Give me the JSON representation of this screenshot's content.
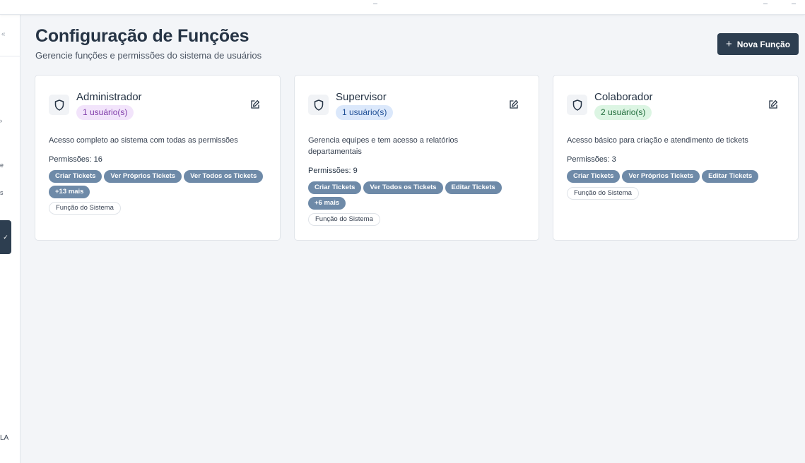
{
  "sidebar": {
    "collapse_icon": "«",
    "frag1": "›",
    "frag2": "e",
    "frag3": "s",
    "active_icon": "✓",
    "bottom_text": "LA"
  },
  "header": {
    "title": "Configuração de Funções",
    "subtitle": "Gerencie funções e permissões do sistema de usuários",
    "new_button_label": "Nova Função",
    "new_button_icon": "plus-icon"
  },
  "roles": [
    {
      "name": "Administrador",
      "users": "1 usuário(s)",
      "badge_bg": "#f2e4fb",
      "badge_fg": "#7e3aa8",
      "description": "Acesso completo ao sistema com todas as permissões",
      "permissions_label": "Permissões: 16",
      "tags": [
        "Criar Tickets",
        "Ver Próprios Tickets",
        "Ver Todos os Tickets",
        "+13 mais"
      ],
      "system_label": "Função do Sistema"
    },
    {
      "name": "Supervisor",
      "users": "1 usuário(s)",
      "badge_bg": "#dbe8fb",
      "badge_fg": "#1f4f96",
      "description": "Gerencia equipes e tem acesso a relatórios departamentais",
      "permissions_label": "Permissões: 9",
      "tags": [
        "Criar Tickets",
        "Ver Todos os Tickets",
        "Editar Tickets",
        "+6 mais"
      ],
      "system_label": "Função do Sistema"
    },
    {
      "name": "Colaborador",
      "users": "2 usuário(s)",
      "badge_bg": "#dcf5e3",
      "badge_fg": "#1f6b3a",
      "description": "Acesso básico para criação e atendimento de tickets",
      "permissions_label": "Permissões: 3",
      "tags": [
        "Criar Tickets",
        "Ver Próprios Tickets",
        "Editar Tickets"
      ],
      "system_label": "Função do Sistema"
    }
  ]
}
